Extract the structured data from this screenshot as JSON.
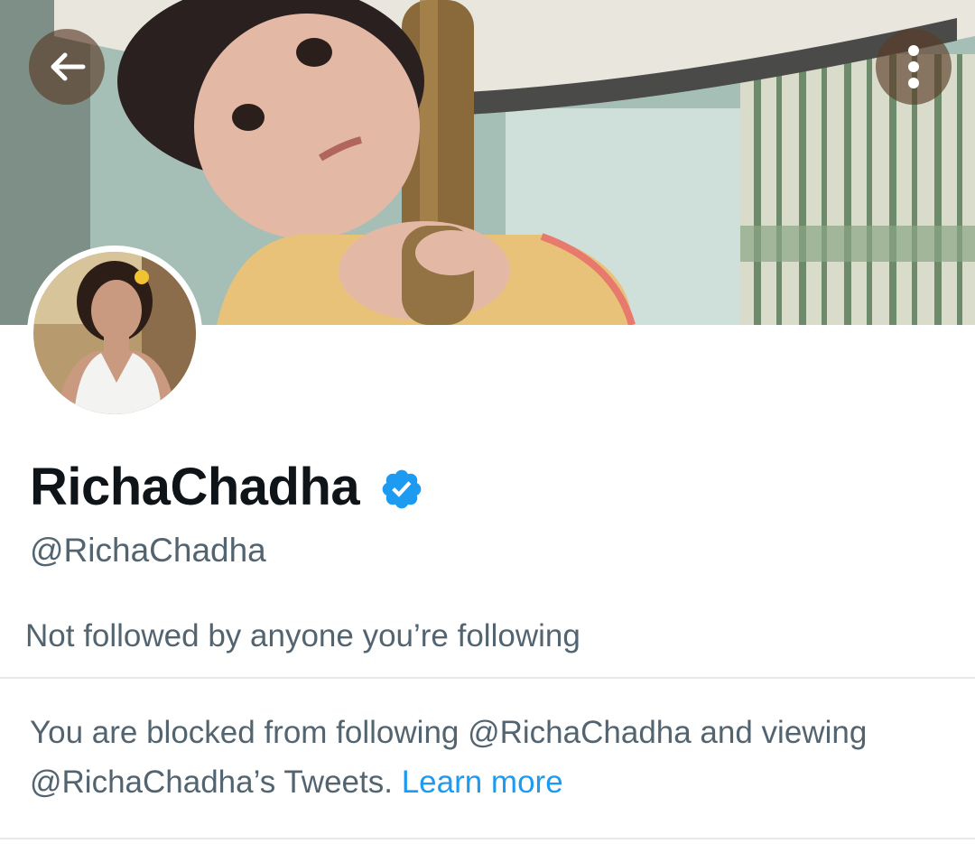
{
  "header": {
    "back_icon": "arrow-left-icon",
    "more_icon": "vertical-ellipsis-icon"
  },
  "profile": {
    "display_name": "RichaChadha",
    "verified_icon": "verified-badge-icon",
    "handle": "@RichaChadha",
    "followers_note": "Not followed by anyone you’re following"
  },
  "blocked": {
    "message": "You are blocked from following @RichaChadha and viewing @RichaChadha’s Tweets.",
    "learn_more": "Learn more"
  },
  "colors": {
    "accent": "#1d9bf0",
    "secondary_text": "#536471",
    "primary_text": "#0f1419"
  }
}
